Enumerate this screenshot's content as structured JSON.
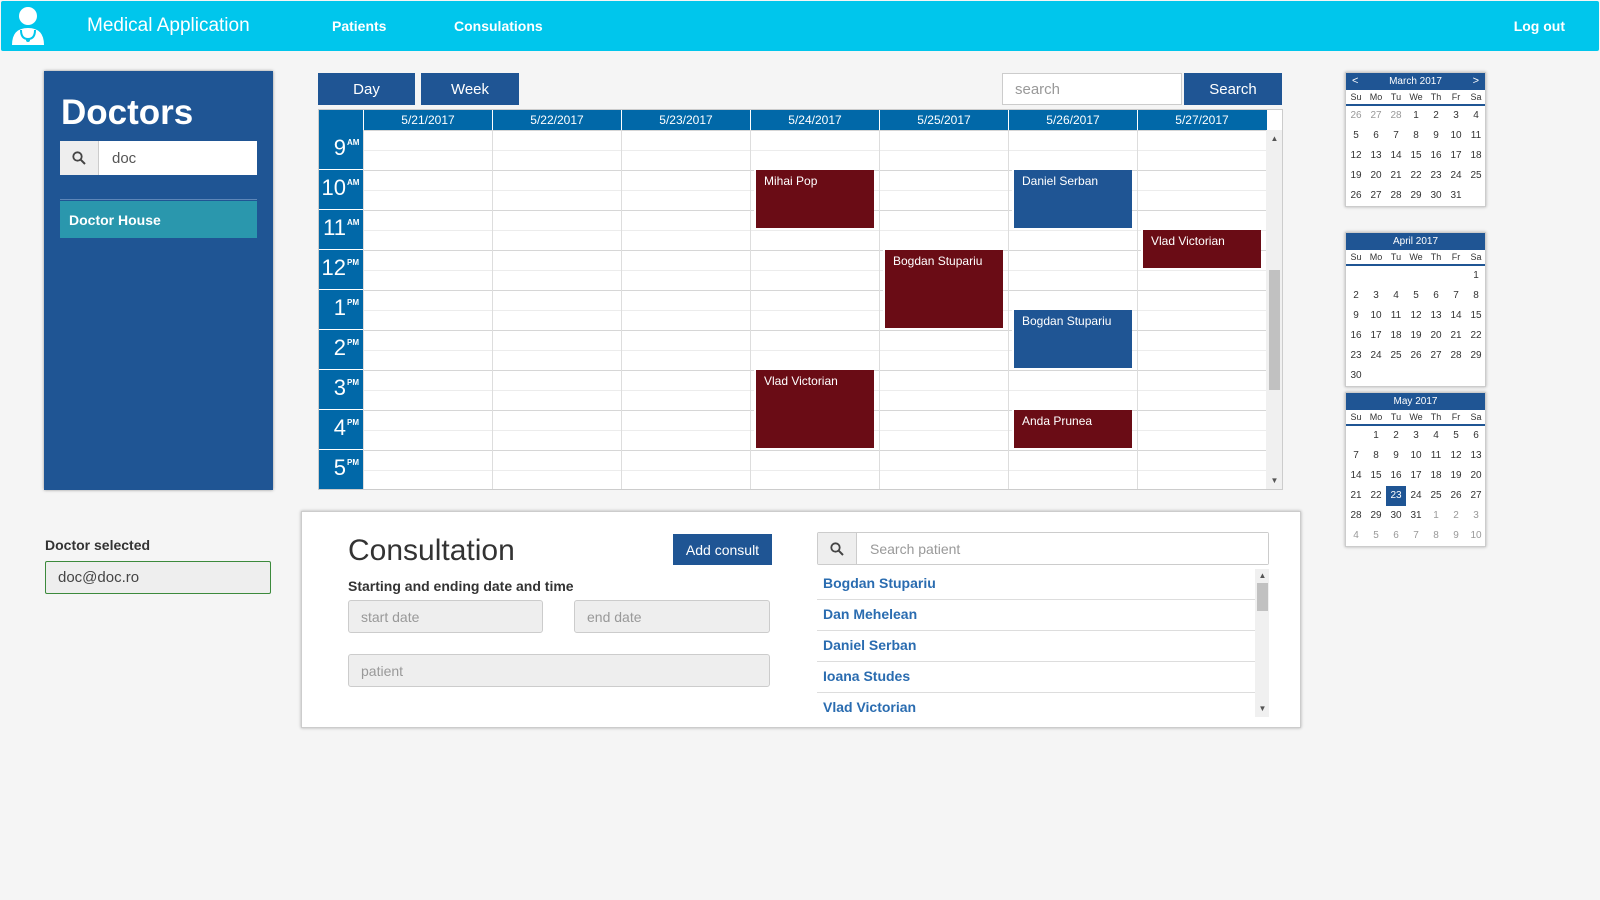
{
  "app": {
    "title": "Medical Application",
    "nav": [
      "Patients",
      "Consulations"
    ],
    "logout": "Log out"
  },
  "doctors": {
    "title": "Doctors",
    "search_value": "doc",
    "items": [
      "Doctor House"
    ],
    "selected_label": "Doctor selected",
    "selected_value": "doc@doc.ro"
  },
  "calendar": {
    "views": [
      "Day",
      "Week"
    ],
    "search_placeholder": "search",
    "search_button": "Search",
    "dates": [
      "5/21/2017",
      "5/22/2017",
      "5/23/2017",
      "5/24/2017",
      "5/25/2017",
      "5/26/2017",
      "5/27/2017"
    ],
    "hours": [
      {
        "num": "9",
        "ampm": "AM"
      },
      {
        "num": "10",
        "ampm": "AM"
      },
      {
        "num": "11",
        "ampm": "AM"
      },
      {
        "num": "12",
        "ampm": "PM"
      },
      {
        "num": "1",
        "ampm": "PM"
      },
      {
        "num": "2",
        "ampm": "PM"
      },
      {
        "num": "3",
        "ampm": "PM"
      },
      {
        "num": "4",
        "ampm": "PM"
      },
      {
        "num": "5",
        "ampm": "PM"
      }
    ],
    "events": [
      {
        "name": "Mihai Pop",
        "day": 3,
        "start": 10,
        "end": 11.5,
        "color": "red"
      },
      {
        "name": "Daniel Serban",
        "day": 5,
        "start": 10,
        "end": 11.5,
        "color": "blue"
      },
      {
        "name": "Vlad Victorian",
        "day": 6,
        "start": 11.5,
        "end": 12.5,
        "color": "red"
      },
      {
        "name": "Bogdan Stupariu",
        "day": 4,
        "start": 12,
        "end": 14,
        "color": "red"
      },
      {
        "name": "Bogdan Stupariu",
        "day": 5,
        "start": 13.5,
        "end": 15,
        "color": "blue"
      },
      {
        "name": "Vlad Victorian",
        "day": 3,
        "start": 15,
        "end": 17,
        "color": "red"
      },
      {
        "name": "Anda Prunea",
        "day": 5,
        "start": 16,
        "end": 17,
        "color": "red"
      }
    ]
  },
  "consultation": {
    "title": "Consultation",
    "subtitle": "Starting and ending date and time",
    "add_button": "Add consult",
    "start_placeholder": "start date",
    "end_placeholder": "end date",
    "patient_placeholder": "patient",
    "patient_search_placeholder": "Search patient",
    "patients": [
      "Bogdan Stupariu",
      "Dan Mehelean",
      "Daniel Serban",
      "Ioana Studes",
      "Vlad Victorian"
    ]
  },
  "mini_calendars": [
    {
      "title": "March 2017",
      "has_nav": true,
      "dow": [
        "Su",
        "Mo",
        "Tu",
        "We",
        "Th",
        "Fr",
        "Sa"
      ],
      "days": [
        "26",
        "27",
        "28",
        "1",
        "2",
        "3",
        "4",
        "5",
        "6",
        "7",
        "8",
        "9",
        "10",
        "11",
        "12",
        "13",
        "14",
        "15",
        "16",
        "17",
        "18",
        "19",
        "20",
        "21",
        "22",
        "23",
        "24",
        "25",
        "26",
        "27",
        "28",
        "29",
        "30",
        "31"
      ],
      "other_first": 3,
      "selected": -1
    },
    {
      "title": "April 2017",
      "has_nav": false,
      "dow": [
        "Su",
        "Mo",
        "Tu",
        "We",
        "Th",
        "Fr",
        "Sa"
      ],
      "days": [
        "",
        "",
        "",
        "",
        "",
        "",
        "1",
        "2",
        "3",
        "4",
        "5",
        "6",
        "7",
        "8",
        "9",
        "10",
        "11",
        "12",
        "13",
        "14",
        "15",
        "16",
        "17",
        "18",
        "19",
        "20",
        "21",
        "22",
        "23",
        "24",
        "25",
        "26",
        "27",
        "28",
        "29",
        "30"
      ],
      "other_first": 0,
      "selected": -1
    },
    {
      "title": "May 2017",
      "has_nav": false,
      "dow": [
        "Su",
        "Mo",
        "Tu",
        "We",
        "Th",
        "Fr",
        "Sa"
      ],
      "days": [
        "",
        "1",
        "2",
        "3",
        "4",
        "5",
        "6",
        "7",
        "8",
        "9",
        "10",
        "11",
        "12",
        "13",
        "14",
        "15",
        "16",
        "17",
        "18",
        "19",
        "20",
        "21",
        "22",
        "23",
        "24",
        "25",
        "26",
        "27",
        "28",
        "29",
        "30",
        "31",
        "1",
        "2",
        "3",
        "4",
        "5",
        "6",
        "7",
        "8",
        "9",
        "10"
      ],
      "other_first": 0,
      "other_after": 32,
      "selected": 23
    }
  ]
}
